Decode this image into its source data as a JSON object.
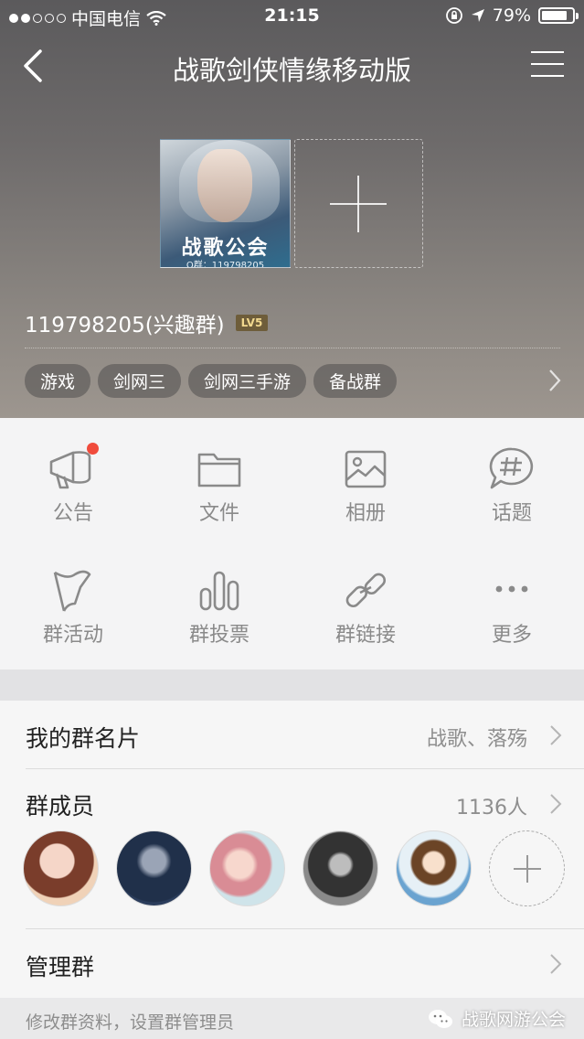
{
  "status_bar": {
    "carrier": "中国电信",
    "time": "21:15",
    "battery": "79%"
  },
  "nav": {
    "title": "战歌剑侠情缘移动版"
  },
  "group": {
    "avatar_banner": "战歌公会",
    "avatar_caption": "Q群：119798205",
    "id_text": "119798205(兴趣群)",
    "level": "LV5",
    "tags": [
      "游戏",
      "剑网三",
      "剑网三手游",
      "备战群"
    ]
  },
  "grid": {
    "row1": [
      {
        "label": "公告",
        "icon": "megaphone-icon",
        "badge": true
      },
      {
        "label": "文件",
        "icon": "folder-icon"
      },
      {
        "label": "相册",
        "icon": "image-icon"
      },
      {
        "label": "话题",
        "icon": "hashtag-icon"
      }
    ],
    "row2": [
      {
        "label": "群活动",
        "icon": "flag-icon"
      },
      {
        "label": "群投票",
        "icon": "bar-chart-icon"
      },
      {
        "label": "群链接",
        "icon": "link-icon"
      },
      {
        "label": "更多",
        "icon": "more-icon"
      }
    ]
  },
  "list": {
    "card_title": "我的群名片",
    "card_value": "战歌、落殇",
    "members_title": "群成员",
    "members_count": "1136人",
    "manage_title": "管理群",
    "manage_note": "修改群资料，设置群管理员"
  },
  "watermark": "战歌网游公会",
  "colors": {
    "badge_red": "#f04b3c",
    "level_badge": "#6e5d3a"
  }
}
